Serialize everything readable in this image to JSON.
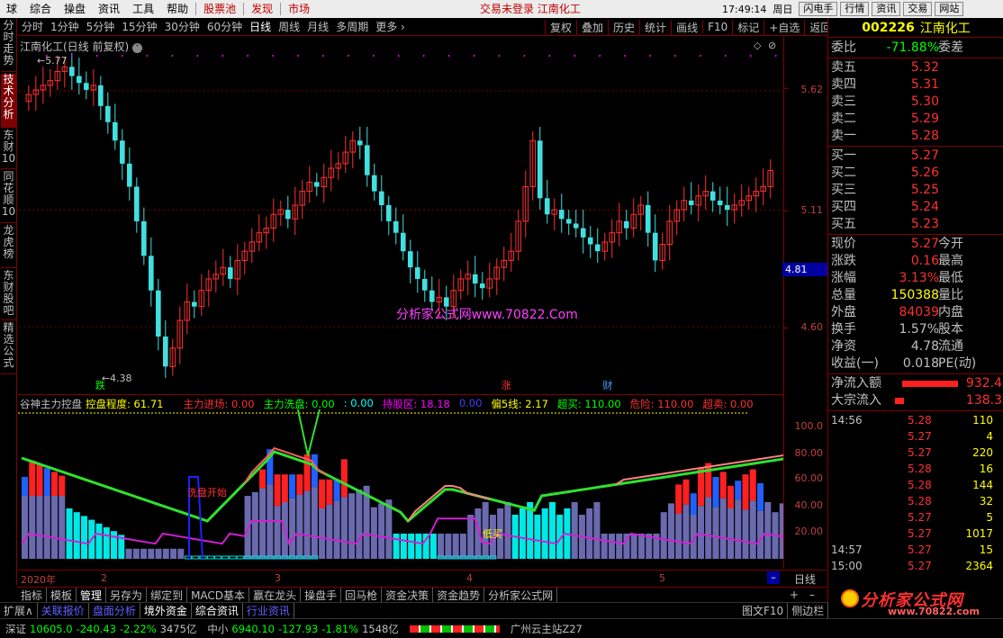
{
  "menu": {
    "items": [
      "球",
      "综合",
      "操盘",
      "资讯",
      "工具",
      "帮助"
    ],
    "red_items": [
      "股票池",
      "发现",
      "市场"
    ],
    "status": "交易未登录  江南化工",
    "time": "17:49:14",
    "weekday": "周日",
    "buttons": [
      "闪电手",
      "行情",
      "资讯",
      "交易",
      "网站"
    ]
  },
  "left_tabs": [
    "分时走势",
    "技术分析",
    "东财10",
    "同花顺10",
    "龙虎榜",
    "东财股吧",
    "精选公式"
  ],
  "periods": [
    "分时",
    "1分钟",
    "5分钟",
    "15分钟",
    "30分钟",
    "60分钟",
    "日线",
    "周线",
    "月线",
    "多周期",
    "更多 ›"
  ],
  "period_selected": "日线",
  "tools": [
    "复权",
    "叠加",
    "历史",
    "统计",
    "画线",
    "F10",
    "标记",
    "+自选",
    "返回"
  ],
  "chart": {
    "title": "江南化工(日线 前复权)",
    "high_label": "5.77",
    "low_label": "4.38",
    "y_ticks": [
      "5.62",
      "5.11",
      "4.60"
    ],
    "current_price": "4.81",
    "watermark": "分析家公式网www.70822.Com",
    "markers": [
      "跌",
      "涨",
      "财"
    ]
  },
  "indicator": {
    "name": "谷神主力控盘",
    "items": [
      {
        "label": "控盘程度: 61.71",
        "color": "#ffff00"
      },
      {
        "label": "主力进场: 0.00",
        "color": "#ff3030"
      },
      {
        "label": "主力洗盘: 0.00",
        "color": "#00ff00"
      },
      {
        "label": ": 0.00",
        "color": "#00ffff"
      },
      {
        "label": "持股区: 18.18",
        "color": "#ff00ff"
      },
      {
        "label": "0.00",
        "color": "#4040ff"
      },
      {
        "label": "偏5线: 2.17",
        "color": "#ffff00"
      },
      {
        "label": "超买: 110.00",
        "color": "#00ff00"
      },
      {
        "label": "危险: 110.00",
        "color": "#ff3030"
      },
      {
        "label": "超卖: 0.00",
        "color": "#ff3030"
      }
    ],
    "y_ticks": [
      "100.0",
      "80.00",
      "60.00",
      "40.00",
      "20.00"
    ],
    "annotations": [
      "洗盘开始",
      "低买"
    ]
  },
  "dates": [
    "2020年",
    "2",
    "3",
    "4",
    "5"
  ],
  "date_period": "日线",
  "bottom_tabs": [
    "指标",
    "模板",
    "管理",
    "另存为",
    "绑定到",
    "MACD基本",
    "赢在龙头",
    "操盘手",
    "回马枪",
    "资金决策",
    "资金趋势",
    "分析家公式网"
  ],
  "expand_tabs": [
    "扩展∧",
    "关联报价",
    "盘面分析",
    "境外资金",
    "综合资讯",
    "行业资讯"
  ],
  "expand_right": [
    "图文F10",
    "侧边栏"
  ],
  "status": {
    "sz_label": "深证",
    "sz_val": "10605.0",
    "sz_chg": "-240.43",
    "sz_pct": "-2.22%",
    "sz_amt": "3475亿",
    "zx_label": "中小",
    "zx_val": "6940.10",
    "zx_chg": "-127.93",
    "zx_pct": "-1.81%",
    "zx_amt": "1548亿",
    "news": "广州云主站Z27"
  },
  "quote": {
    "code": "002226",
    "name": "江南化工",
    "weibi": {
      "k": "委比",
      "v": "-71.88%",
      "k2": "委差"
    },
    "sells": [
      {
        "k": "卖五",
        "v": "5.32"
      },
      {
        "k": "卖四",
        "v": "5.31"
      },
      {
        "k": "卖三",
        "v": "5.30"
      },
      {
        "k": "卖二",
        "v": "5.29"
      },
      {
        "k": "卖一",
        "v": "5.28"
      }
    ],
    "buys": [
      {
        "k": "买一",
        "v": "5.27"
      },
      {
        "k": "买二",
        "v": "5.26"
      },
      {
        "k": "买三",
        "v": "5.25"
      },
      {
        "k": "买四",
        "v": "5.24"
      },
      {
        "k": "买五",
        "v": "5.23"
      }
    ],
    "stats": [
      {
        "k": "现价",
        "v": "5.27",
        "c": "#ff3030",
        "k2": "今开"
      },
      {
        "k": "涨跌",
        "v": "0.16",
        "c": "#ff3030",
        "k2": "最高"
      },
      {
        "k": "涨幅",
        "v": "3.13%",
        "c": "#ff3030",
        "k2": "最低"
      },
      {
        "k": "总量",
        "v": "150388",
        "c": "#ffff00",
        "k2": "量比"
      },
      {
        "k": "外盘",
        "v": "84039",
        "c": "#ff3030",
        "k2": "内盘"
      },
      {
        "k": "换手",
        "v": "1.57%",
        "c": "#c0c0c0",
        "k2": "股本"
      },
      {
        "k": "净资",
        "v": "4.78",
        "c": "#c0c0c0",
        "k2": "流通"
      },
      {
        "k": "收益(一)",
        "v": "0.018",
        "c": "#c0c0c0",
        "k2": "PE(动)"
      }
    ],
    "flows": [
      {
        "k": "净流入额",
        "v": "932.4"
      },
      {
        "k": "大宗流入",
        "v": "138.3"
      }
    ],
    "ticks": [
      {
        "t": "14:56",
        "p": "5.28",
        "v": "110"
      },
      {
        "t": "",
        "p": "5.27",
        "v": "4"
      },
      {
        "t": "",
        "p": "5.27",
        "v": "220"
      },
      {
        "t": "",
        "p": "5.28",
        "v": "16"
      },
      {
        "t": "",
        "p": "5.28",
        "v": "144"
      },
      {
        "t": "",
        "p": "5.28",
        "v": "32"
      },
      {
        "t": "",
        "p": "5.27",
        "v": "5"
      },
      {
        "t": "",
        "p": "5.27",
        "v": "1017"
      },
      {
        "t": "14:57",
        "p": "5.27",
        "v": "15"
      },
      {
        "t": "15:00",
        "p": "5.27",
        "v": "2364"
      }
    ]
  },
  "watermark": {
    "main": "分析家公式网",
    "url": "www.70822.com"
  }
}
